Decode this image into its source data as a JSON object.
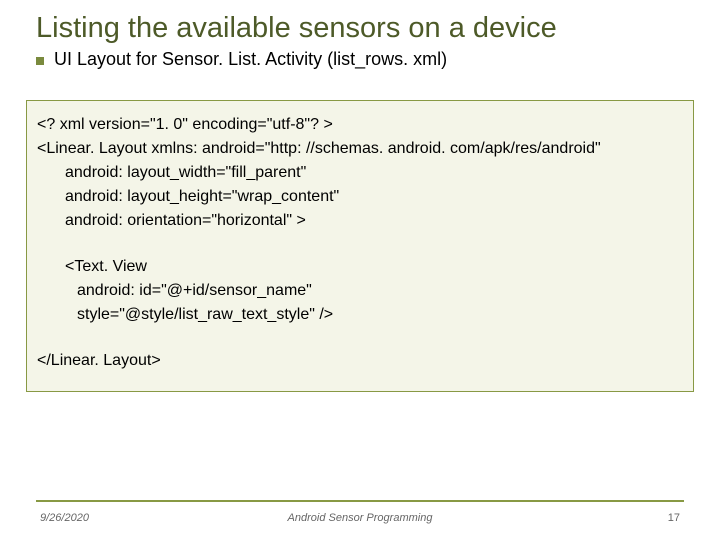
{
  "title": "Listing the available sensors on a device",
  "subtitle": "UI Layout for Sensor. List. Activity (list_rows. xml)",
  "code": {
    "line1": "<? xml version=\"1. 0\" encoding=\"utf-8\"? >",
    "line2": "<Linear. Layout xmlns: android=\"http: //schemas. android. com/apk/res/android\"",
    "line3": "android: layout_width=\"fill_parent\"",
    "line4": "android: layout_height=\"wrap_content\"",
    "line5": "android: orientation=\"horizontal\" >",
    "line6": "<Text. View",
    "line7": "android: id=\"@+id/sensor_name\"",
    "line8": "style=\"@style/list_raw_text_style\" />",
    "line9": "</Linear. Layout>"
  },
  "footer": {
    "date": "9/26/2020",
    "title": "Android Sensor Programming",
    "page": "17"
  }
}
